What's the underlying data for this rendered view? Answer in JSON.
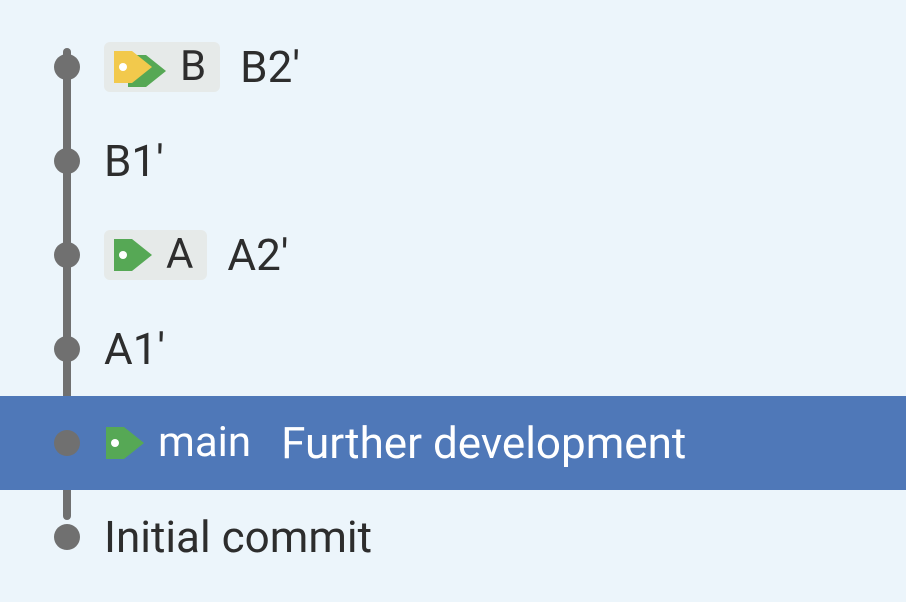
{
  "colors": {
    "background": "#ecf5fb",
    "rail": "#707070",
    "dot": "#707070",
    "selection": "#4f78b8",
    "badge_bg": "#e6eae9",
    "tag_green": "#56a855",
    "tag_yellow": "#f2c94c"
  },
  "commits": [
    {
      "message": "B2'",
      "selected": false,
      "branch": {
        "label": "B",
        "tag_style": "double",
        "colors": [
          "#f2c94c",
          "#56a855"
        ]
      }
    },
    {
      "message": "B1'",
      "selected": false,
      "branch": null
    },
    {
      "message": "A2'",
      "selected": false,
      "branch": {
        "label": "A",
        "tag_style": "single",
        "colors": [
          "#56a855"
        ]
      }
    },
    {
      "message": "A1'",
      "selected": false,
      "branch": null
    },
    {
      "message": "Further development",
      "selected": true,
      "branch": {
        "label": "main",
        "tag_style": "single",
        "colors": [
          "#56a855"
        ]
      }
    },
    {
      "message": "Initial commit",
      "selected": false,
      "branch": null
    }
  ]
}
